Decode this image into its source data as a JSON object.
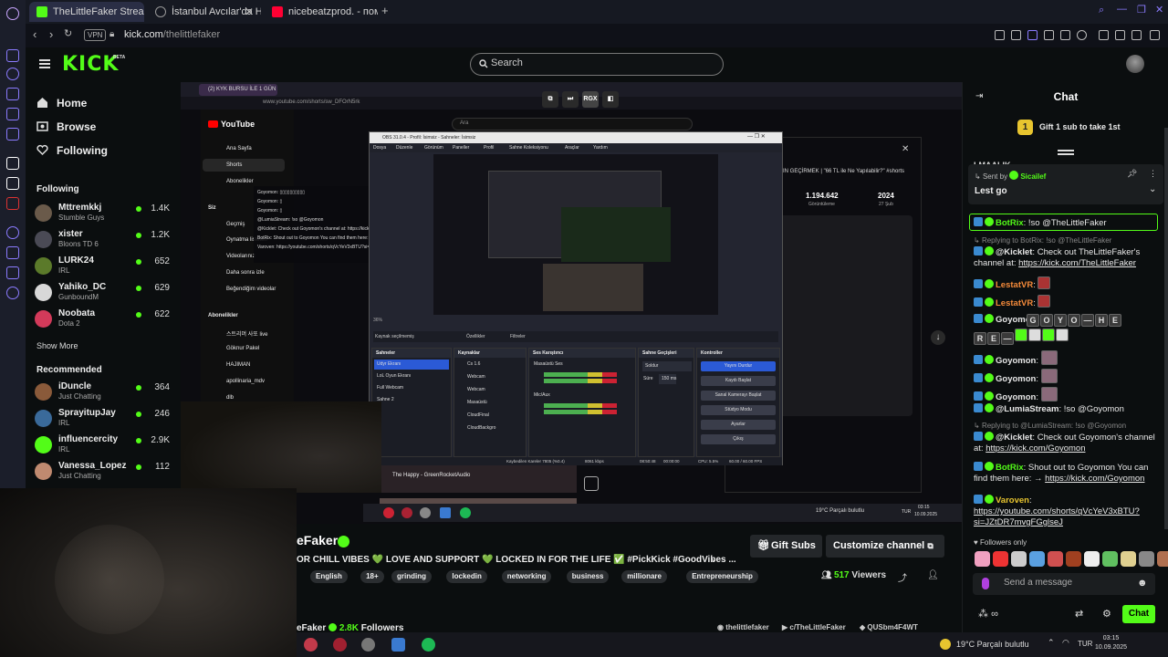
{
  "browser": {
    "tabs": [
      {
        "title": "TheLittleFaker Stream - W",
        "color": "#53fc18"
      },
      {
        "title": "İstanbul Avcılar'da Ha",
        "color": "#999999"
      },
      {
        "title": "nicebeatzprod. - помогите",
        "color": "#ff0033"
      }
    ],
    "vpn": "VPN",
    "url_host": "kick.com",
    "url_path": "/thelittlefaker"
  },
  "header": {
    "logo": "KICK",
    "logo_badge": "BETA",
    "search_placeholder": "Search"
  },
  "nav": {
    "home": "Home",
    "browse": "Browse",
    "following": "Following"
  },
  "following": {
    "title": "Following",
    "channels": [
      {
        "name": "Mttremkkj",
        "category": "Stumble Guys",
        "viewers": "1.4K",
        "color": "#6a5a4a"
      },
      {
        "name": "xister",
        "category": "Bloons TD 6",
        "viewers": "1.2K",
        "color": "#4a4a55"
      },
      {
        "name": "LURK24",
        "category": "IRL",
        "viewers": "652",
        "color": "#5b7a2a"
      },
      {
        "name": "Yahiko_DC",
        "category": "GunboundM",
        "viewers": "629",
        "color": "#d8d8d8"
      },
      {
        "name": "Noobata",
        "category": "Dota 2",
        "viewers": "622",
        "color": "#d33a5a"
      }
    ],
    "show_more": "Show More"
  },
  "recommended": {
    "title": "Recommended",
    "channels": [
      {
        "name": "iDuncle",
        "category": "Just Chatting",
        "viewers": "364",
        "color": "#8a5a3a"
      },
      {
        "name": "SprayitupJay",
        "category": "IRL",
        "viewers": "246",
        "color": "#3a6a9a"
      },
      {
        "name": "influencercity",
        "category": "IRL",
        "viewers": "2.9K",
        "color": "#53fc18"
      },
      {
        "name": "Vanessa_Lopez",
        "category": "Just Chatting",
        "viewers": "112",
        "color": "#c08a70"
      }
    ]
  },
  "screen": {
    "inner_tab": "(2) KYK BURSU İLE 1 GÜN",
    "inner_url": "www.youtube.com/shorts/sw_DFOrN5rk",
    "controls": [
      "RGX"
    ],
    "yt": {
      "logo": "YouTube",
      "search": "Ara",
      "items": [
        "Ana Sayfa",
        "Shorts",
        "Abonelikler",
        "Siz",
        "Geçmiş",
        "Oynatma listeleri",
        "Videolarınız",
        "Daha sonra izle",
        "Beğendiğim videolar",
        "Abonelikler",
        "스트리머 사또 live",
        "Göknur Pakel",
        "HAJIMAN",
        "apollinaria_mdv",
        "dlb"
      ]
    },
    "overlay_chat": [
      "Goyomon: ▯▯▯▯▯▯▯▯▯▯",
      "Goyomon: ▯",
      "Goyomon: ▯",
      "@LumiaStream: !so @Goyomon",
      "@Kicklet: Check out Goyomon's channel at: https://kick.com/goyomon",
      "BotRix: Shout out to Goyomon You can find them here: → https://kick.com/goyomon",
      "Varoven: https://youtube.com/shorts/qVcYeV3xBTU?si=JZtDR7mvgFGglseJ"
    ],
    "obs": {
      "title": "OBS 31.0.4 - Profil: İsimsiz - Sahneler: İsimsiz",
      "menu": [
        "Dosya",
        "Düzenle",
        "Görünüm",
        "Paneller",
        "Profil",
        "Sahne Koleksiyonu",
        "Araçlar",
        "Yardım"
      ],
      "source_selected": "Kaynak seçilmemiş",
      "props": "Özellikler",
      "filters": "Filtreler",
      "scenes_title": "Sahneler",
      "scenes": [
        "Udyr Ekranı",
        "LoL Oyun Ekranı",
        "Full Webcam",
        "Sahne 2"
      ],
      "sources_title": "Kaynaklar",
      "sources": [
        "Cs 1.6",
        "Webcam",
        "Webcam",
        "Masaüstü",
        "CloudFinal",
        "CloudBackgro"
      ],
      "mixer_title": "Ses Karıştırıcı",
      "mixer": [
        "Masaüstü Ses",
        "Mic/Aux"
      ],
      "transitions_title": "Sahne Geçişleri",
      "transition": "Soldur",
      "duration_label": "Süre",
      "duration": "150 ms",
      "controls_title": "Kontroller",
      "controls": [
        "Yayını Durdur",
        "Kaydı Başlat",
        "Sanal Kamerayı Başlat",
        "Stüdyo Modu",
        "Ayarlar",
        "Çıkış"
      ],
      "status": [
        "Kaybedilen Kareler 7805 (%0.4)",
        "8061 kbps",
        "08:50:48",
        "00:00:00",
        "CPU: 5.5%",
        "60.00 / 60.00 FPS"
      ]
    },
    "yt_stats": {
      "likes": "1.194.642",
      "likes_label": "Görüntüleme",
      "year": "2024",
      "date": "27 Şub"
    },
    "yt_video_title": "IN GEÇİRMEK | \"66 TL ile Ne Yapılabilir?\" #shorts",
    "song": "The Happy - GreenRocketAudio",
    "inner_taskbar": {
      "weather": "19°C Parçalı bulutlu",
      "lang": "TUR",
      "time": "03:15",
      "date": "10.09.2025"
    }
  },
  "stream": {
    "title": "eFaker",
    "description": "OR CHILL VIBES 💚 LOVE AND SUPPORT 💚 LOCKED IN FOR THE LIFE ✅ #PickKick #GoodVibes ...",
    "tags": [
      "English",
      "18+",
      "grinding",
      "lockedin",
      "networking",
      "business",
      "millionare",
      "Entrepreneurship"
    ],
    "gift_subs": "Gift Subs",
    "customize": "Customize channel",
    "viewers": "517",
    "viewers_label": "Viewers",
    "channel_short": "eFaker",
    "followers": "2.8K",
    "followers_label": "Followers",
    "socials": [
      "thelittlefaker",
      "c/TheLittleFaker",
      "QUSbm4F4WT"
    ]
  },
  "taskbar": {
    "weather": "19°C  Parçalı bulutlu",
    "lang": "TUR",
    "time": "03:15",
    "date": "10.09.2025"
  },
  "chat": {
    "title": "Chat",
    "gift_banner": "Gift 1 sub to take 1st",
    "gift_badge": "1",
    "peek": "LMAALIK",
    "pinned_by_label": "Sent by",
    "pinned_by_user": "Sicailef",
    "pinned_msg": "Lest go",
    "messages": [
      {
        "user": "BotRix",
        "text": "!so @TheLittleFaker",
        "color": "#53fc18"
      },
      {
        "reply": "Replying to BotRix: !so @TheLittleFaker"
      },
      {
        "user": "@Kicklet",
        "text": "Check out TheLittleFaker's channel at:",
        "link": "https://kick.com/TheLittleFaker",
        "color": "#e8e8e8"
      },
      {
        "user": "LestatVR",
        "text": "",
        "color": "#f48a3a"
      },
      {
        "user": "LestatVR",
        "text": "",
        "color": "#f48a3a"
      },
      {
        "user": "Goyomon",
        "text": "",
        "color": "#e8e8e8"
      },
      {
        "user": "Goyomon",
        "text": "",
        "color": "#e8e8e8"
      },
      {
        "user": "Goyomon",
        "text": "",
        "color": "#e8e8e8"
      },
      {
        "user": "Goyomon",
        "text": "",
        "color": "#e8e8e8"
      },
      {
        "user": "@LumiaStream",
        "text": "!so @Goyomon",
        "color": "#e8e8e8"
      },
      {
        "reply": "Replying to @LumiaStream: !so @Goyomon"
      },
      {
        "user": "@Kicklet",
        "text": "Check out Goyomon's channel at:",
        "link": "https://kick.com/Goyomon",
        "color": "#e8e8e8"
      },
      {
        "user": "BotRix",
        "text": "Shout out to Goyomon You can find them here: →",
        "link": "https://kick.com/Goyomon",
        "color": "#53fc18"
      },
      {
        "user": "Varoven",
        "text": "",
        "link": "https://youtube.com/shorts/qVcYeV3xBTU?si=JZtDR7mvgFGglseJ",
        "color": "#e8c52f"
      }
    ],
    "emote_row_1": [
      "G",
      "O",
      "Y",
      "O",
      "—",
      "H",
      "E"
    ],
    "emote_row_2": [
      "R",
      "E",
      "—",
      "",
      "",
      "",
      ""
    ],
    "followers_only": "Followers only",
    "input_placeholder": "Send a message",
    "send": "Chat",
    "points_label": "∞"
  }
}
